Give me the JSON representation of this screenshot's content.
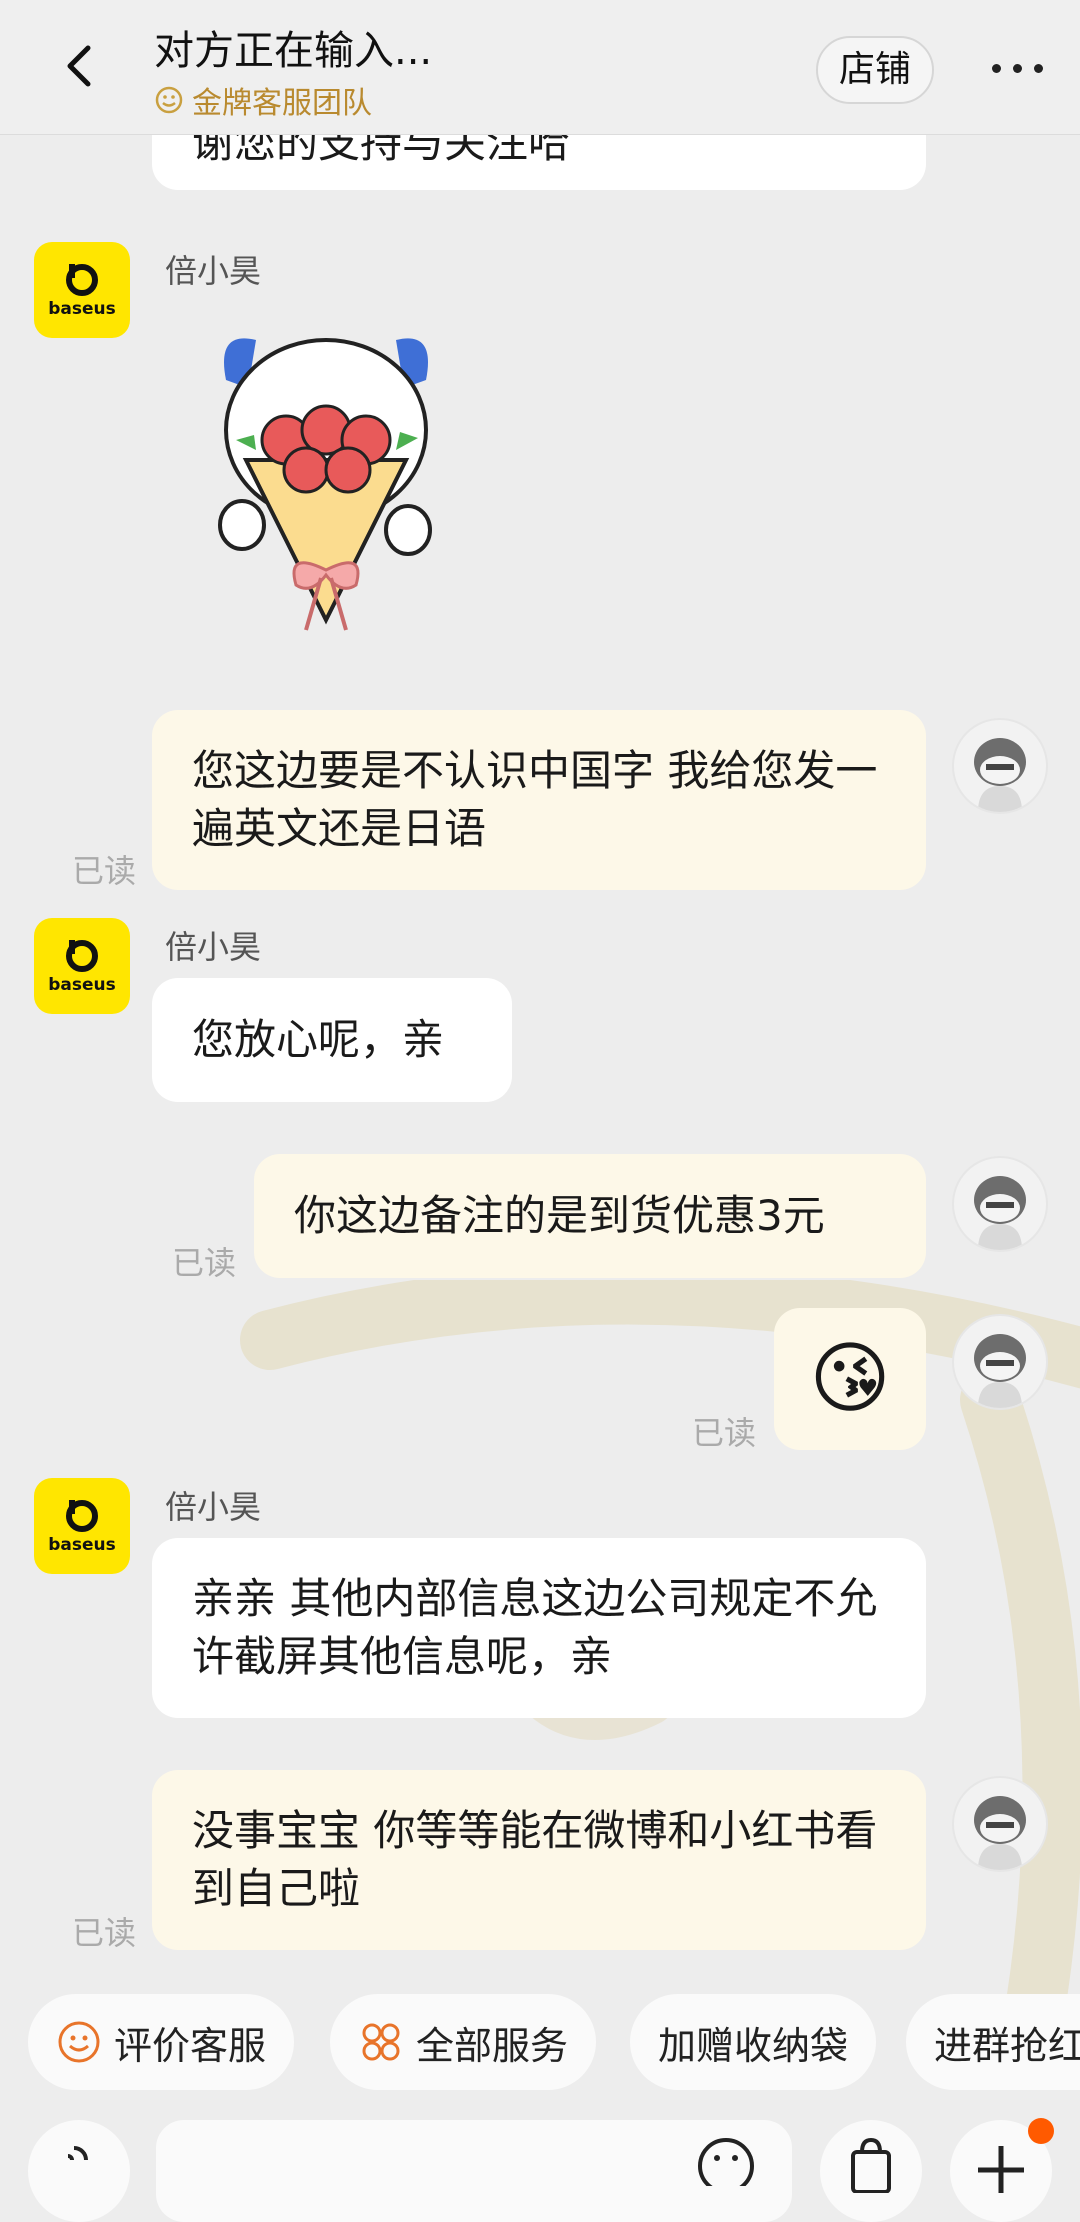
{
  "header": {
    "title": "对方正在输入...",
    "subtitle": "金牌客服团队",
    "store_button": "店铺",
    "more_icon": "more-dots-icon",
    "back_icon": "chevron-left-icon"
  },
  "colors": {
    "background": "#ededed",
    "shop_avatar": "#ffe600",
    "left_bubble": "#ffffff",
    "right_bubble": "#fdf8e8",
    "accent_gold": "#b98a2f",
    "notification_dot": "#ff5a00"
  },
  "messages": [
    {
      "side": "left",
      "text": "谢您的支持与关注哈"
    },
    {
      "side": "left",
      "sender": "倍小昊",
      "avatar_label": "baseus",
      "sticker": "flower-bouquet-sticker"
    },
    {
      "side": "right",
      "text": "您这边要是不认识中国字 我给您发一遍英文还是日语",
      "status": "已读"
    },
    {
      "side": "left",
      "sender": "倍小昊",
      "avatar_label": "baseus",
      "text": "您放心呢，亲"
    },
    {
      "side": "right",
      "text": "你这边备注的是到货优惠3元",
      "status": "已读"
    },
    {
      "side": "right",
      "text": "😘",
      "status": "已读"
    },
    {
      "side": "left",
      "sender": "倍小昊",
      "avatar_label": "baseus",
      "text": "亲亲 其他内部信息这边公司规定不允许截屏其他信息呢，亲"
    },
    {
      "side": "right",
      "text": "没事宝宝 你等等能在微博和小红书看到自己啦",
      "status": "已读"
    }
  ],
  "quick_actions": [
    {
      "label": "评价客服",
      "icon": "smile-icon"
    },
    {
      "label": "全部服务",
      "icon": "grid-icon"
    },
    {
      "label": "加赠收纳袋"
    },
    {
      "label": "进群抢红"
    }
  ],
  "input_bar": {
    "voice_icon": "voice-icon",
    "emoji_icon": "emoji-icon",
    "bag_icon": "shopping-bag-icon",
    "plus_icon": "plus-icon"
  }
}
